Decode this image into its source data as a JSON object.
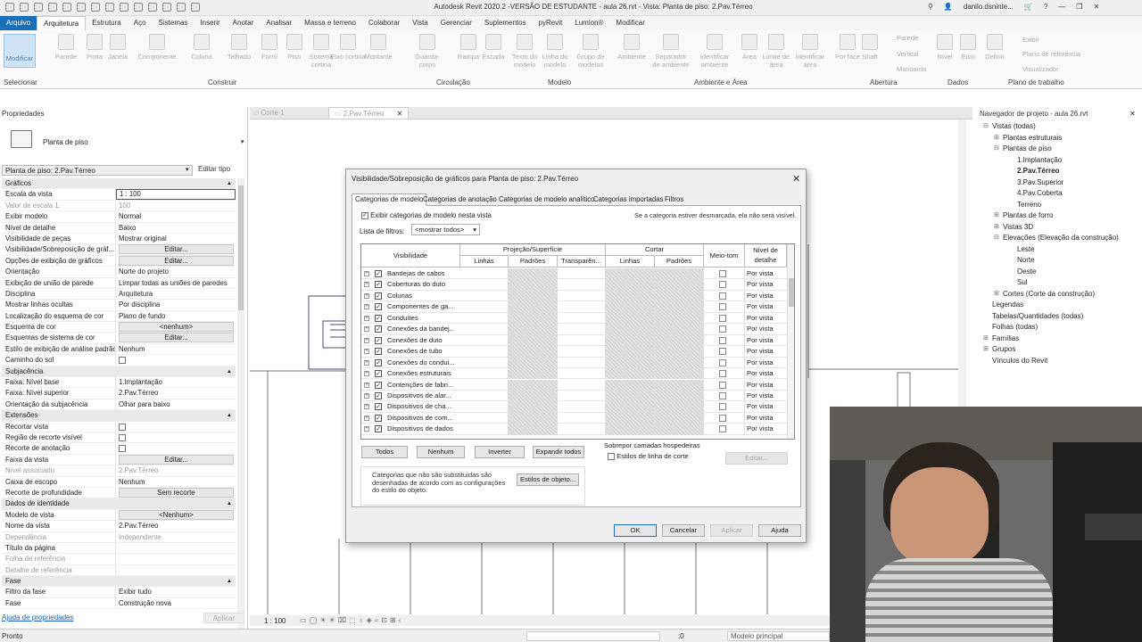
{
  "app": {
    "title": "Autodesk Revit 2020.2 -VERSÃO DE ESTUDANTE - aula 26.rvt - Vista: Planta de piso: 2.Pav.Térreo",
    "user": "danilo.dsninte..."
  },
  "menu": [
    "Arquivo",
    "Arquitetura",
    "Estrutura",
    "Aço",
    "Sistemas",
    "Inserir",
    "Anotar",
    "Analisar",
    "Massa e terreno",
    "Colaborar",
    "Vista",
    "Gerenciar",
    "Suplementos",
    "pyRevit",
    "Lumion®",
    "Modificar"
  ],
  "ribbon": {
    "modify": "Modificar",
    "tools": [
      "Parede",
      "Porta",
      "Janela",
      "Componente",
      "Coluna",
      "Telhado",
      "Forro",
      "Piso",
      "Sistema cortina",
      "Eixo cortina",
      "Montante",
      "Guarda-corpo",
      "Rampa",
      "Escada",
      "Texto do modelo",
      "Linha do modelo",
      "Grupo de modelos",
      "Ambiente",
      "Separador de ambiente",
      "Identificar ambiente",
      "Área",
      "Limite de área",
      "Identificar área",
      "Por face",
      "Shaft",
      "Nível",
      "Eixo",
      "Definir"
    ],
    "small": [
      "Parede",
      "Vertical",
      "Mansarda",
      "Exibir",
      "Plano de referência",
      "Visualizador"
    ],
    "panels": [
      "Selecionar",
      "Construir",
      "Circulação",
      "Modelo",
      "Ambiente e Área",
      "Abertura",
      "Dados",
      "Plano de trabalho"
    ]
  },
  "properties": {
    "title": "Propriedades",
    "type": "Planta de piso",
    "instance": "Planta de piso: 2.Pav.Térreo",
    "edit_type": "Editar tipo",
    "rows": [
      {
        "k": "Gráficos",
        "section": true
      },
      {
        "k": "Escala da vista",
        "v": "1 : 100",
        "input": true
      },
      {
        "k": "Valor de escala    1:",
        "v": "100",
        "gray": true
      },
      {
        "k": "Exibir modelo",
        "v": "Normal"
      },
      {
        "k": "Nível de detalhe",
        "v": "Baixo"
      },
      {
        "k": "Visibilidade de peças",
        "v": "Mostrar original"
      },
      {
        "k": "Visibilidade/Sobreposição de gráf...",
        "v": "Editar...",
        "btn": true
      },
      {
        "k": "Opções de exibição de gráficos",
        "v": "Editar...",
        "btn": true
      },
      {
        "k": "Orientação",
        "v": "Norte do projeto"
      },
      {
        "k": "Exibição de união de parede",
        "v": "Limpar todas as uniões de paredes"
      },
      {
        "k": "Disciplina",
        "v": "Arquitetura"
      },
      {
        "k": "Mostrar linhas ocultas",
        "v": "Por disciplina"
      },
      {
        "k": "Localização do esquema de cor",
        "v": "Plano de fundo"
      },
      {
        "k": "Esquema de cor",
        "v": "<nenhum>",
        "btn": true
      },
      {
        "k": "Esquemas de sistema de cor",
        "v": "Editar...",
        "btn": true
      },
      {
        "k": "Estilo de exibição de análise padrão",
        "v": "Nenhum"
      },
      {
        "k": "Caminho do sol",
        "v": "",
        "check": true
      },
      {
        "k": "Subjacência",
        "section": true
      },
      {
        "k": "Faixa: Nível base",
        "v": "1.Implantação"
      },
      {
        "k": "Faixa: Nível superior",
        "v": "2.Pav.Térreo"
      },
      {
        "k": "Orientação da subjacência",
        "v": "Olhar para baixo"
      },
      {
        "k": "Extensões",
        "section": true
      },
      {
        "k": "Recortar vista",
        "v": "",
        "check": true
      },
      {
        "k": "Região de recorte visível",
        "v": "",
        "check": true
      },
      {
        "k": "Recorte de anotação",
        "v": "",
        "check": true
      },
      {
        "k": "Faixa da vista",
        "v": "Editar...",
        "btn": true
      },
      {
        "k": "Nível associado",
        "v": "2.Pav.Térreo",
        "gray": true
      },
      {
        "k": "Caixa de escopo",
        "v": "Nenhum"
      },
      {
        "k": "Recorte de profundidade",
        "v": "Sem recorte",
        "btn": true
      },
      {
        "k": "Dados de identidade",
        "section": true
      },
      {
        "k": "Modelo de vista",
        "v": "<Nenhum>",
        "btn": true
      },
      {
        "k": "Nome da vista",
        "v": "2.Pav.Térreo"
      },
      {
        "k": "Dependência",
        "v": "Independente",
        "gray": true
      },
      {
        "k": "Título da página",
        "v": ""
      },
      {
        "k": "Folha de referência",
        "v": "",
        "gray": true
      },
      {
        "k": "Detalhe de referência",
        "v": "",
        "gray": true
      },
      {
        "k": "Fase",
        "section": true
      },
      {
        "k": "Filtro da fase",
        "v": "Exibir tudo"
      },
      {
        "k": "Fase",
        "v": "Construção nova"
      }
    ],
    "help": "Ajuda de propriedades",
    "apply": "Aplicar"
  },
  "view_tabs": [
    "Corte 1",
    "2.Pav.Térreo"
  ],
  "viewbar": {
    "scale": "1 : 100"
  },
  "browser": {
    "title": "Navegador de projeto - aula 26.rvt",
    "items": [
      {
        "t": "Vistas (todas)",
        "l": 1,
        "e": "-"
      },
      {
        "t": "Plantas estruturais",
        "l": 2,
        "e": "+"
      },
      {
        "t": "Plantas de piso",
        "l": 2,
        "e": "-"
      },
      {
        "t": "1.Implantação",
        "l": 3
      },
      {
        "t": "2.Pav.Térreo",
        "l": 3,
        "b": true
      },
      {
        "t": "3.Pav.Superior",
        "l": 3
      },
      {
        "t": "4.Pav.Coberta",
        "l": 3
      },
      {
        "t": "Terreno",
        "l": 3
      },
      {
        "t": "Plantas de forro",
        "l": 2,
        "e": "+"
      },
      {
        "t": "Vistas 3D",
        "l": 2,
        "e": "+"
      },
      {
        "t": "Elevações (Elevação da construção)",
        "l": 2,
        "e": "-"
      },
      {
        "t": "Leste",
        "l": 3
      },
      {
        "t": "Norte",
        "l": 3
      },
      {
        "t": "Oeste",
        "l": 3
      },
      {
        "t": "Sul",
        "l": 3
      },
      {
        "t": "Cortes (Corte da construção)",
        "l": 2,
        "e": "+"
      },
      {
        "t": "Legendas",
        "l": 1
      },
      {
        "t": "Tabelas/Quantidades (todas)",
        "l": 1
      },
      {
        "t": "Folhas (todas)",
        "l": 1
      },
      {
        "t": "Famílias",
        "l": 1,
        "e": "+"
      },
      {
        "t": "Grupos",
        "l": 1,
        "e": "+"
      },
      {
        "t": "Vínculos do Revit",
        "l": 1
      }
    ]
  },
  "status": {
    "left": "Pronto",
    "right": ":0",
    "model": "Modelo principal"
  },
  "dialog": {
    "title": "Visibilidade/Sobreposição de gráficos para Planta de piso: 2.Pav.Térreo",
    "tabs": [
      "Categorias de modelo",
      "Categorias de anotação",
      "Categorias de modelo analítico",
      "Categorias importadas",
      "Filtros"
    ],
    "show_cats": "Exibir categorias de modelo nesta vista",
    "hint": "Se a categoria estiver desmarcada, ela não será visível.",
    "filter_label": "Lista de filtros:",
    "filter_value": "<mostrar todos>",
    "headers": {
      "vis": "Visibilidade",
      "proj": "Projeção/Superfície",
      "cut": "Cortar",
      "halftone": "Meio-tom",
      "detail": "Nível de detalhe",
      "lines": "Linhas",
      "patterns": "Padrões",
      "transp": "Transparên...",
      "cut_lines": "Linhas",
      "cut_patterns": "Padrões"
    },
    "rows": [
      "Bandejas de cabos",
      "Coberturas do duto",
      "Colunas",
      "Componentes de ga...",
      "Conduítes",
      "Conexões da bandej...",
      "Conexões de duto",
      "Conexões de tubo",
      "Conexões do condui...",
      "Conexões estruturais",
      "Contenções de fabri...",
      "Dispositivos de alar...",
      "Dispositivos de cha...",
      "Dispositivos de com...",
      "Dispositivos de dados"
    ],
    "detail_value": "Por vista",
    "buttons": {
      "all": "Todos",
      "none": "Nenhum",
      "invert": "Inverter",
      "expand": "Expandir todos"
    },
    "host_title": "Sobrepor camadas hospedeiras",
    "host_check": "Estilos de linha de corte",
    "host_edit": "Editar...",
    "note": "Categorias que não são substituídas são desenhadas de acordo com as configurações do estilo do objeto.",
    "obj_styles": "Estilos de objeto...",
    "ok": "OK",
    "cancel": "Cancelar",
    "apply": "Aplicar",
    "help": "Ajuda"
  }
}
